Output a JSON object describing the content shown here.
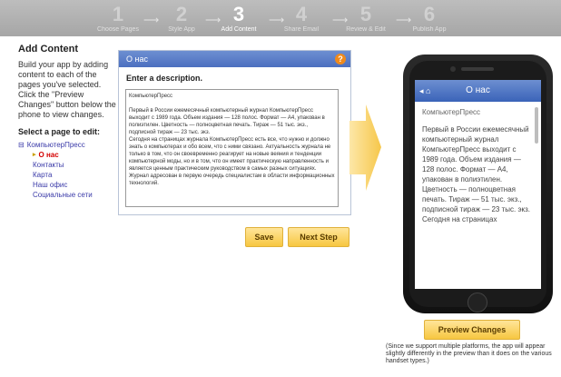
{
  "steps": [
    {
      "num": "1",
      "label": "Choose Pages"
    },
    {
      "num": "2",
      "label": "Style App"
    },
    {
      "num": "3",
      "label": "Add Content"
    },
    {
      "num": "4",
      "label": "Share Email"
    },
    {
      "num": "5",
      "label": "Review & Edit"
    },
    {
      "num": "6",
      "label": "Publish App"
    }
  ],
  "left": {
    "title": "Add Content",
    "description": "Build your app by adding content to each of the pages you've selected. Click the \"Preview Changes\" button below the phone to view changes.",
    "select_label": "Select a page to edit:",
    "tree_root": "КомпьютерПресс",
    "pages": [
      "О нас",
      "Контакты",
      "Карта",
      "Наш офис",
      "Социальные сети"
    ]
  },
  "editor": {
    "panel_title": "О нас",
    "help": "?",
    "prompt": "Enter a description.",
    "text": "КомпьютерПресс\n\nПервый в России ежемесячный компьютерный журнал КомпьютерПресс выходит с 1989 года. Объем издания — 128 полос. Формат — А4, упакован в полиэтилен. Цветность — полноцветная печать. Тираж — 51 тыс. экз., подписной тираж — 23 тыс. экз.\nСегодня на страницах журнала КомпьютерПресс есть все, что нужно и должно знать о компьютерах и обо всем, что с ними связано. Актуальность журнала не только в том, что он своевременно реагирует на новые веяния и тенденции компьютерной моды, но и в том, что он имеет практическую направленность и является ценным практическим руководством в самых разных ситуациях. Журнал адресован в первую очередь специалистам в области информационных технологий.",
    "save": "Save",
    "next": "Next Step"
  },
  "phone": {
    "back": "◂",
    "title": "О нас",
    "heading": "КомпьютерПресс",
    "body": "Первый в России ежемесячный компьютерный журнал КомпьютерПресс выходит с 1989 года. Объем издания — 128 полос. Формат — А4, упакован в полиэтилен. Цветность — полноцветная печать. Тираж — 51 тыс. экз., подписной тираж — 23 тыс. экз. Сегодня на страницах"
  },
  "preview": {
    "label": "Preview Changes"
  },
  "note": "(Since we support multiple platforms, the app will appear slightly differently in the preview than it does on the various handset types.)"
}
